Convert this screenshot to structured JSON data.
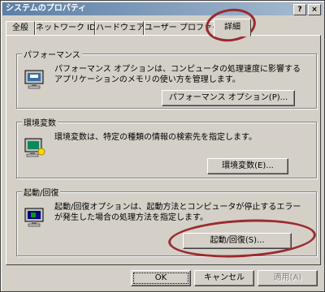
{
  "window": {
    "title": "システムのプロパティ",
    "help_label": "?",
    "close_label": "×"
  },
  "tabs": [
    {
      "label": "全般"
    },
    {
      "label": "ネットワーク ID"
    },
    {
      "label": "ハードウェア"
    },
    {
      "label": "ユーザー プロファイル"
    },
    {
      "label": "詳細"
    }
  ],
  "groups": {
    "performance": {
      "title": "パフォーマンス",
      "description": "パフォーマンス オプションは、コンピュータの処理速度に影響するアプリケーションのメモリの使い方を管理します。",
      "button": "パフォーマンス オプション(P)...",
      "icon": "monitor-gauge-icon"
    },
    "environment": {
      "title": "環境変数",
      "description": "環境変数は、特定の種類の情報の検索先を指定します。",
      "button": "環境変数(E)...",
      "icon": "monitor-sun-icon"
    },
    "startup": {
      "title": "起動/回復",
      "description": "起動/回復オプションは、起動方法とコンピュータが停止するエラーが発生した場合の処理方法を指定します。",
      "button": "起動/回復(S)...",
      "icon": "monitor-startup-icon"
    }
  },
  "footer": {
    "ok": "OK",
    "cancel": "キャンセル",
    "apply": "適用(A)"
  },
  "colors": {
    "annotation": "#9a2b2f",
    "titlebar": "#5b7fa6"
  }
}
